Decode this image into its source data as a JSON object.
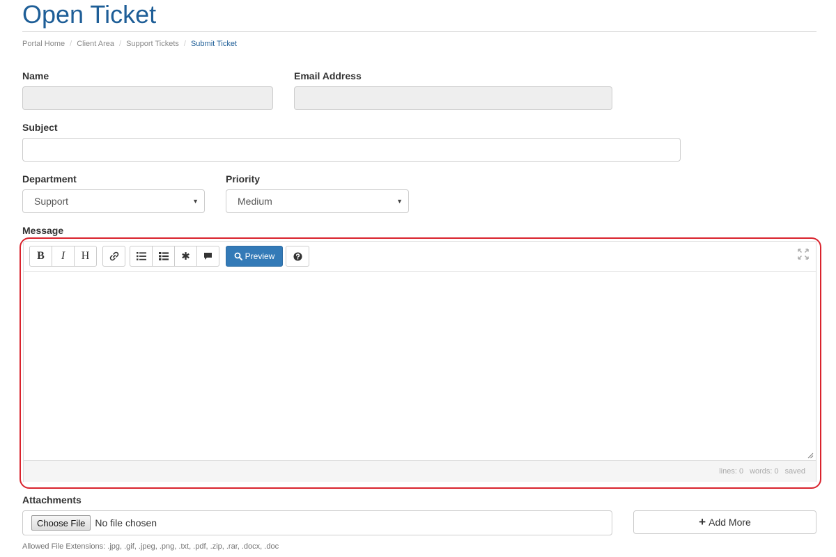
{
  "header": {
    "title": "Open Ticket"
  },
  "breadcrumb": {
    "items": [
      "Portal Home",
      "Client Area",
      "Support Tickets"
    ],
    "active": "Submit Ticket"
  },
  "form": {
    "name_label": "Name",
    "name_value": "",
    "email_label": "Email Address",
    "email_value": "",
    "subject_label": "Subject",
    "subject_value": "",
    "department_label": "Department",
    "department_value": "Support",
    "priority_label": "Priority",
    "priority_value": "Medium",
    "message_label": "Message"
  },
  "editor": {
    "toolbar": {
      "bold_label": "B",
      "italic_label": "I",
      "heading_label": "H",
      "preview_label": "Preview"
    },
    "icons": [
      "link-icon",
      "bullet-list-icon",
      "numbered-list-icon",
      "asterisk-icon",
      "comment-icon",
      "search-icon",
      "question-circle-icon",
      "expand-icon",
      "resize-handle-icon"
    ],
    "status": {
      "lines": "lines: 0",
      "words": "words: 0",
      "saved": "saved"
    }
  },
  "attachments": {
    "label": "Attachments",
    "choose_button": "Choose File",
    "no_file": "No file chosen",
    "add_more": "Add More",
    "allowed": "Allowed File Extensions: .jpg, .gif, .jpeg, .png, .txt, .pdf, .zip, .rar, .docx, .doc"
  },
  "colors": {
    "title": "#1e5e97",
    "primary_button": "#337ab7",
    "highlight": "#d9232d"
  }
}
